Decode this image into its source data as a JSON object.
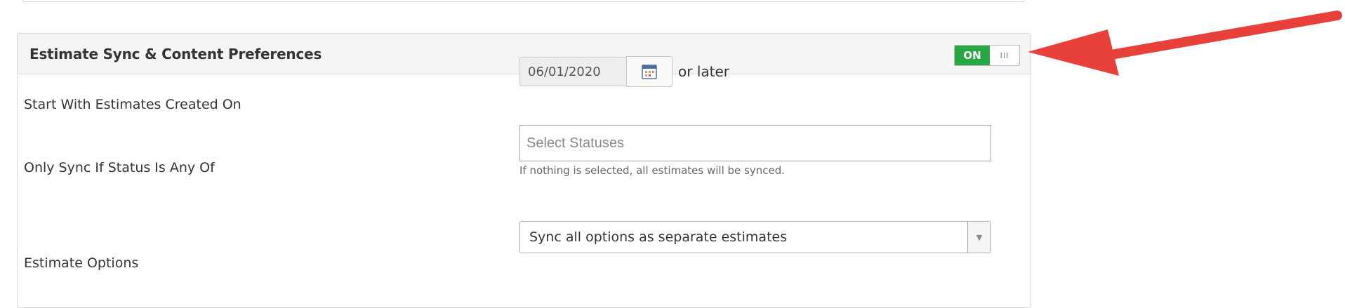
{
  "panel": {
    "title": "Estimate Sync & Content Preferences",
    "toggle": {
      "state_label": "ON",
      "handle_glyph": "III",
      "on_color": "#28a745"
    }
  },
  "fields": {
    "start_date": {
      "label": "Start With Estimates Created On",
      "value": "06/01/2020",
      "suffix": "or later",
      "icon": "calendar-icon"
    },
    "status_filter": {
      "label": "Only Sync If Status Is Any Of",
      "placeholder": "Select Statuses",
      "help": "If nothing is selected, all estimates will be synced."
    },
    "estimate_options": {
      "label": "Estimate Options",
      "selected": "Sync all options as separate estimates",
      "icon": "chevron-down-icon"
    }
  },
  "annotation": {
    "arrow_color": "#e8403a"
  }
}
